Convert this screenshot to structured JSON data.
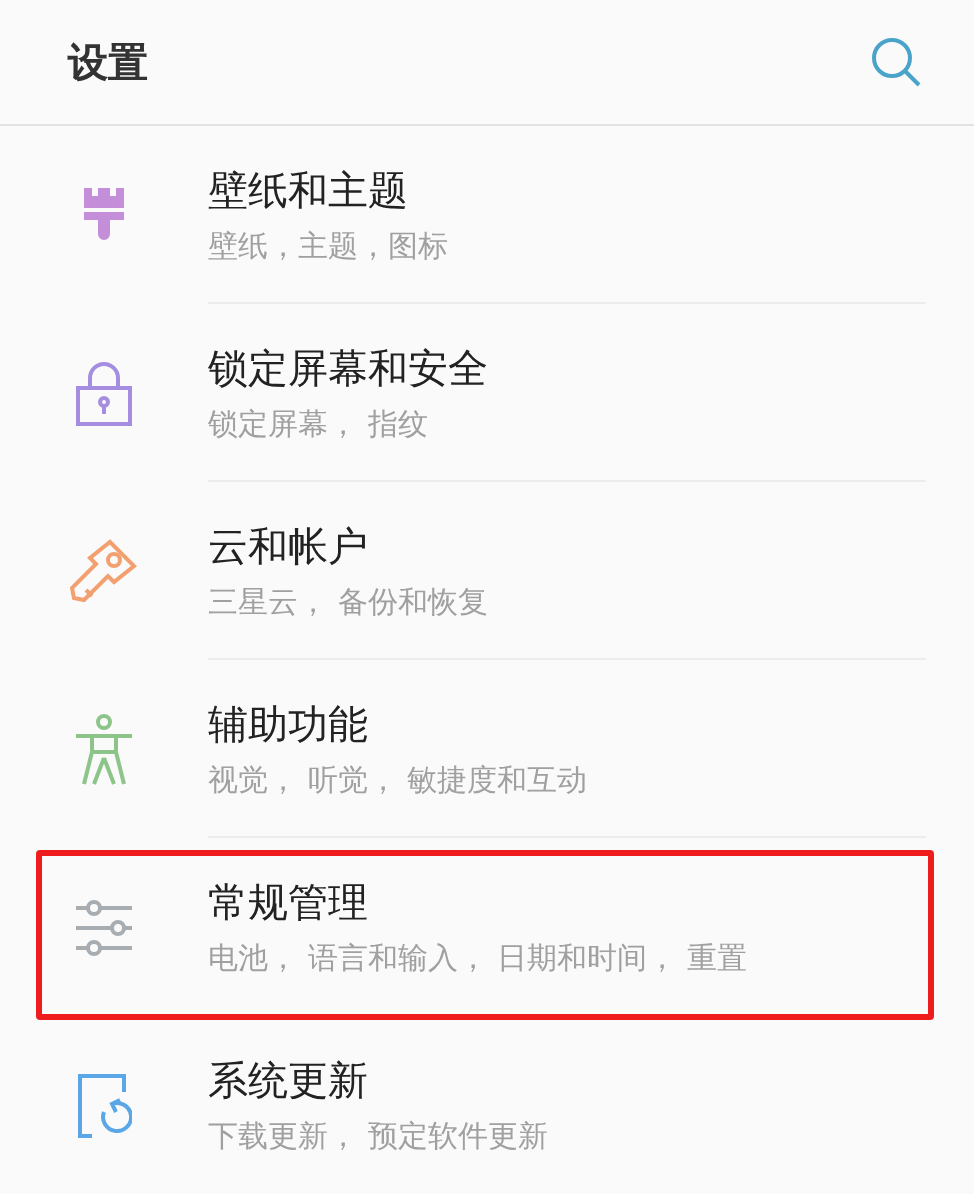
{
  "header": {
    "title": "设置"
  },
  "items": [
    {
      "kind": "brush",
      "title": "壁纸和主题",
      "subtitle": "壁纸，主题，图标",
      "highlighted": false
    },
    {
      "kind": "lock",
      "title": "锁定屏幕和安全",
      "subtitle": "锁定屏幕， 指纹",
      "highlighted": false
    },
    {
      "kind": "key",
      "title": "云和帐户",
      "subtitle": "三星云， 备份和恢复",
      "highlighted": false
    },
    {
      "kind": "person",
      "title": "辅助功能",
      "subtitle": "视觉， 听觉， 敏捷度和互动",
      "highlighted": false
    },
    {
      "kind": "sliders",
      "title": "常规管理",
      "subtitle": "电池， 语言和输入， 日期和时间， 重置",
      "highlighted": true
    },
    {
      "kind": "update",
      "title": "系统更新",
      "subtitle": "下载更新， 预定软件更新",
      "highlighted": false
    }
  ]
}
